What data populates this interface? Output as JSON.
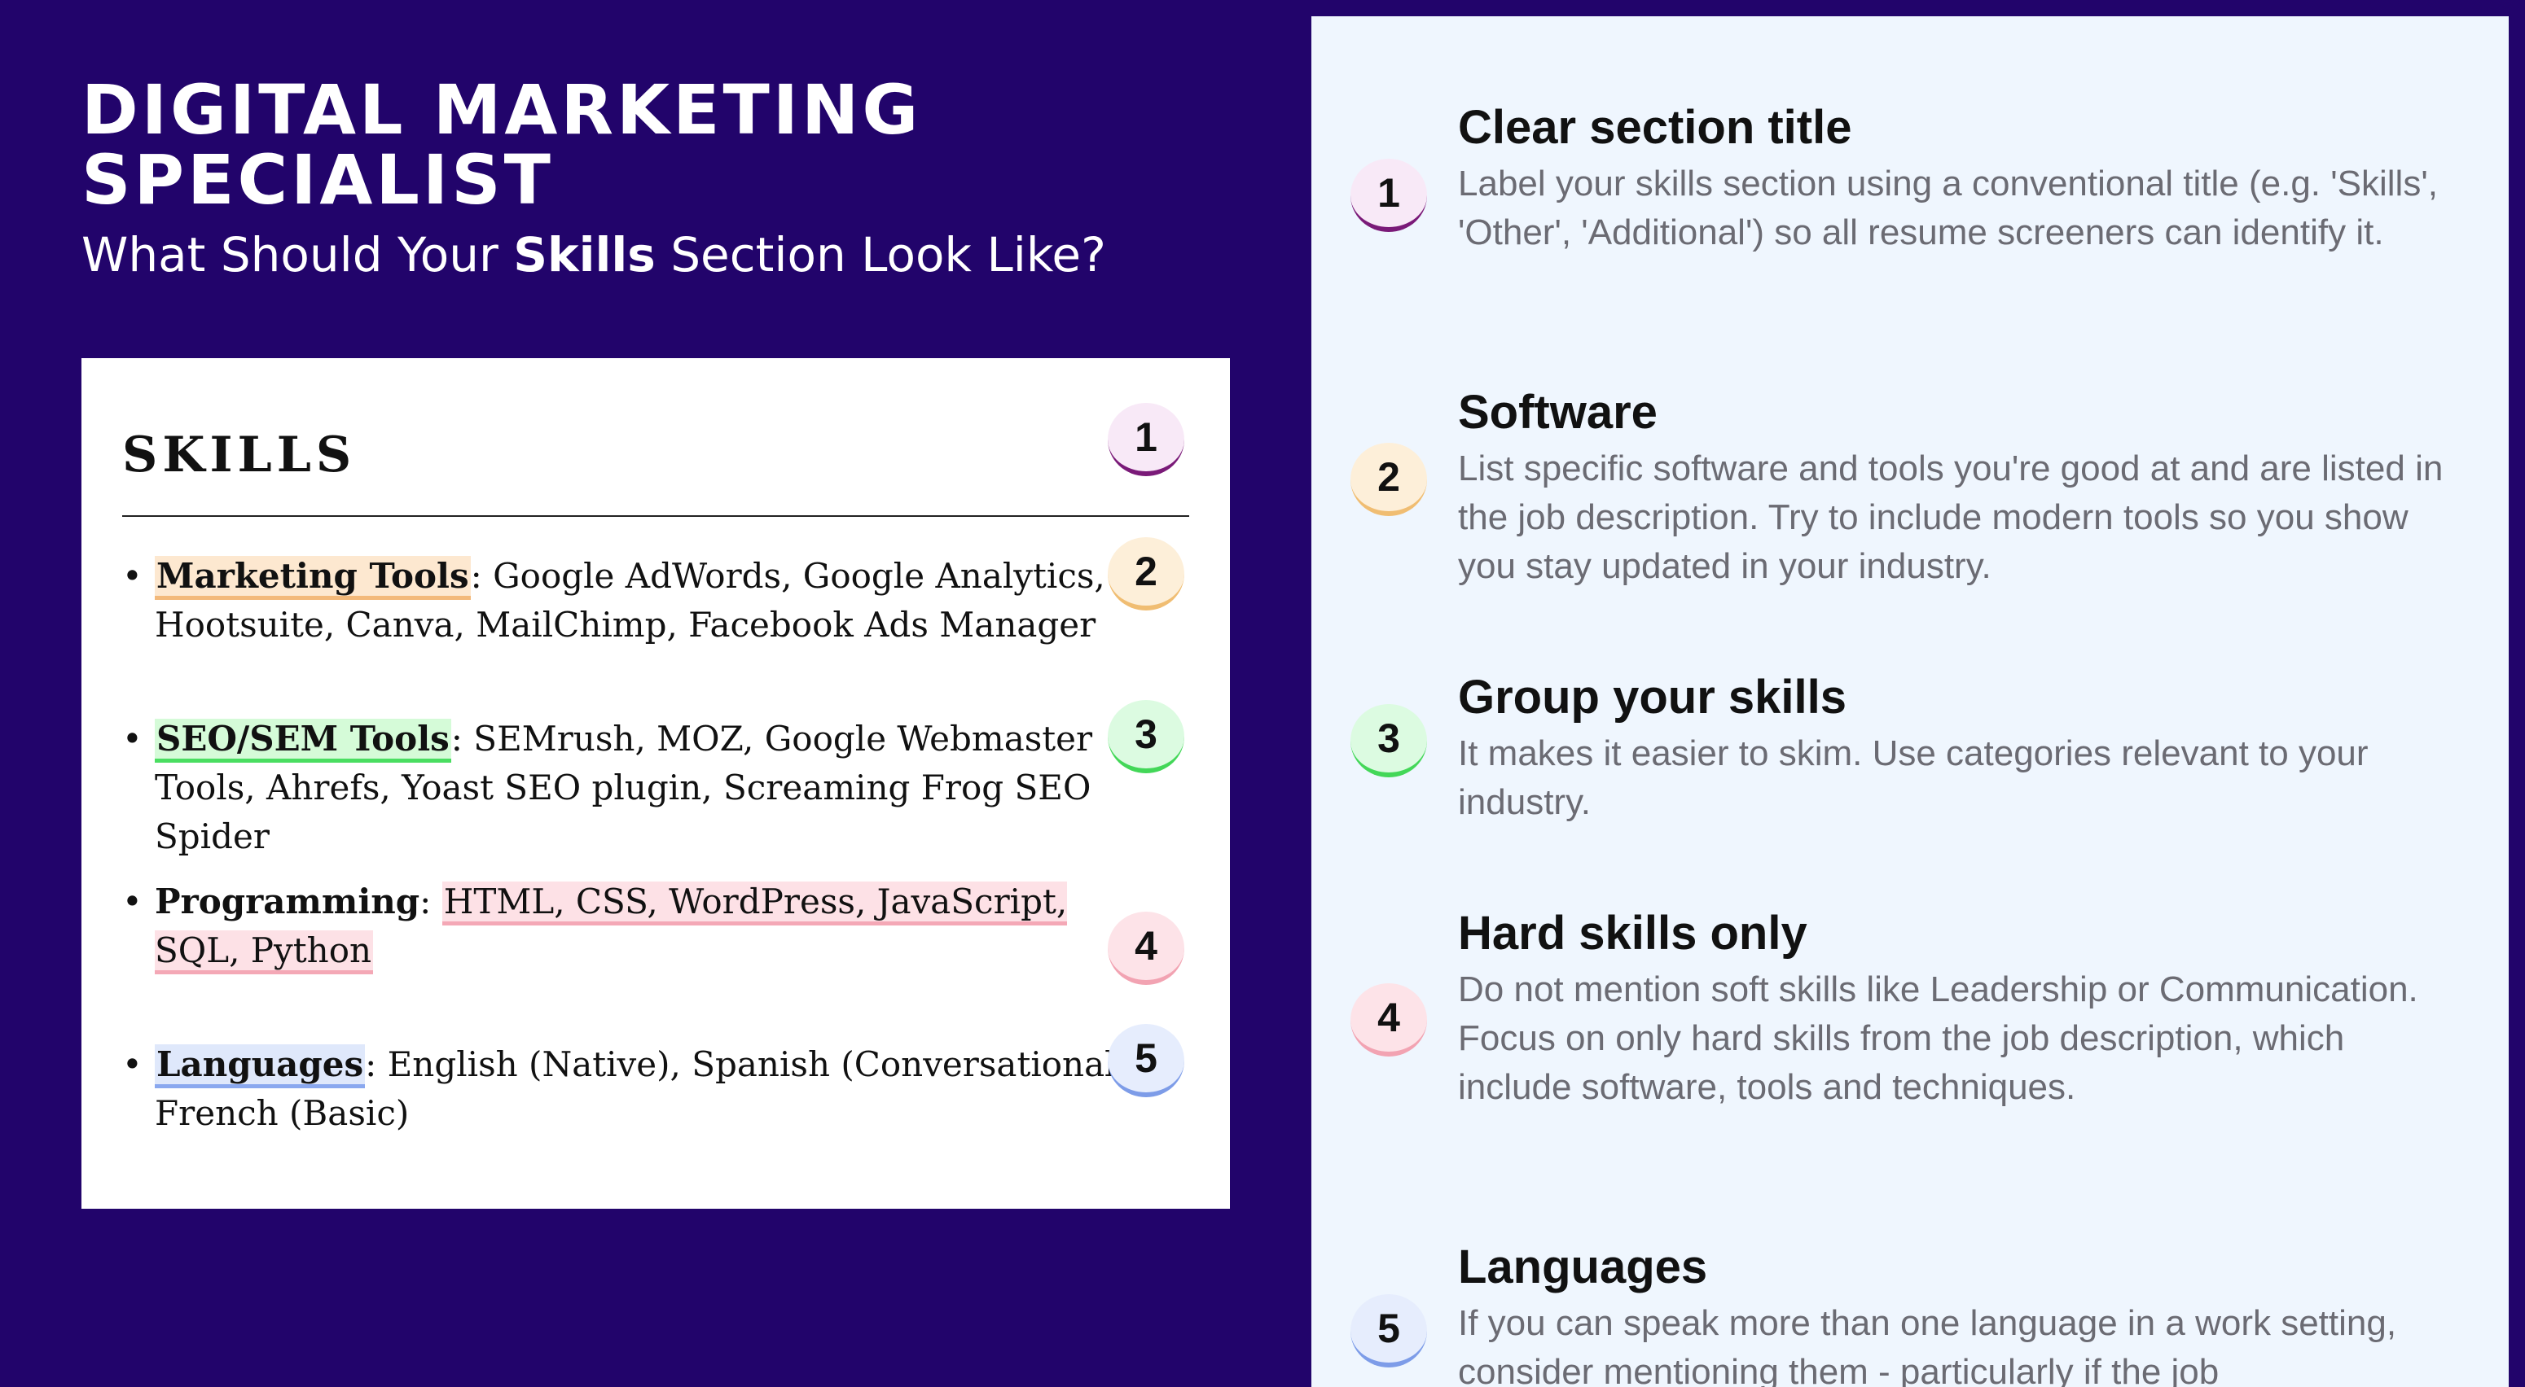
{
  "header": {
    "job_title": "DIGITAL MARKETING SPECIALIST",
    "subtitle_before": "What Should Your ",
    "subtitle_bold": "Skills",
    "subtitle_after": " Section Look Like?"
  },
  "resume": {
    "heading": "SKILLS",
    "bullet": "•",
    "skills": [
      {
        "label": "Marketing Tools",
        "rest": ": Google AdWords, Google Analytics, Hootsuite, Canva, MailChimp, Facebook Ads Manager"
      },
      {
        "label": "SEO/SEM Tools",
        "rest": ": SEMrush, MOZ, Google Webmaster Tools, Ahrefs, Yoast SEO plugin, Screaming Frog SEO Spider"
      },
      {
        "label": "Programming",
        "sep": ": ",
        "rest": "HTML, CSS, WordPress, JavaScript, SQL, Python"
      },
      {
        "label": "Languages",
        "rest": ": English (Native), Spanish (Conversational), French (Basic)"
      }
    ],
    "badges": [
      "1",
      "2",
      "3",
      "4",
      "5"
    ]
  },
  "tips": [
    {
      "number": "1",
      "title": "Clear section title",
      "body": "Label your skills section using a conventional title (e.g. 'Skills', 'Other', 'Additional') so all resume screeners can identify it."
    },
    {
      "number": "2",
      "title": "Software",
      "body": "List specific software and tools you're good at and are listed in the job description. Try to include modern tools so you show you stay updated in your industry."
    },
    {
      "number": "3",
      "title": "Group your skills",
      "body": "It makes it easier to skim. Use categories relevant to your industry."
    },
    {
      "number": "4",
      "title": "Hard skills only",
      "body": "Do not mention soft skills like Leadership or Communication. Focus on only hard skills from the job description, which include software, tools and techniques."
    },
    {
      "number": "5",
      "title": "Languages",
      "body": "If you can speak more than one language in a work setting, consider mentioning them - particularly if the job"
    }
  ],
  "colors": {
    "background": "#22046b",
    "panel": "#eff6fe",
    "badge_1": "#7a1a78",
    "badge_2": "#f0bd72",
    "badge_3": "#43d758",
    "badge_4": "#f2a3b2",
    "badge_5": "#7d9ce8"
  }
}
